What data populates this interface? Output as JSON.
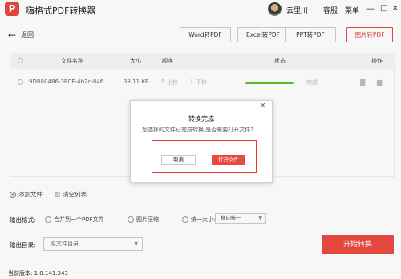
{
  "app": {
    "logo_letter": "P",
    "title": "嗨格式PDF转换器",
    "username": "云里川",
    "service": "客服",
    "menu": "菜单",
    "brand_color": "#e8483e"
  },
  "window_controls": {
    "minimize": "—",
    "maximize": "□",
    "close": "✕"
  },
  "toolbar": {
    "back_label": "返回",
    "tabs": [
      {
        "label": "Word转PDF",
        "active": false
      },
      {
        "label": "Excel转PDF",
        "active": false
      },
      {
        "label": "PPT转PDF",
        "active": false
      },
      {
        "label": "图片转PDF",
        "active": true
      }
    ]
  },
  "table": {
    "headers": {
      "name": "文件名称",
      "size": "大小",
      "order": "顺序",
      "status": "状态",
      "action": "操作"
    },
    "rows": [
      {
        "name": "9DB80486-3ECE-4b2c-846...",
        "size": "38.11 KB",
        "order_up": "上移",
        "order_down": "下移",
        "progress": 1.0,
        "status": "完成"
      }
    ]
  },
  "dialog": {
    "title": "转换完成",
    "message": "您选择的文件已完成转换,是否需要打开文件?",
    "cancel": "取消",
    "open": "打开文件",
    "close_icon": "×"
  },
  "file_actions": {
    "add": "添加文件",
    "clear": "清空列表"
  },
  "output_format": {
    "label": "输出格式:",
    "merge": "合并到一个PDF文件",
    "compress": "图片压缩",
    "uniform_size": "统一大小:",
    "uniform_option": "横向统一"
  },
  "output_dir": {
    "label": "输出目录:",
    "value": "原文件目录"
  },
  "start_button": "开始转换",
  "version": "当前版本: 1.0.141.343"
}
